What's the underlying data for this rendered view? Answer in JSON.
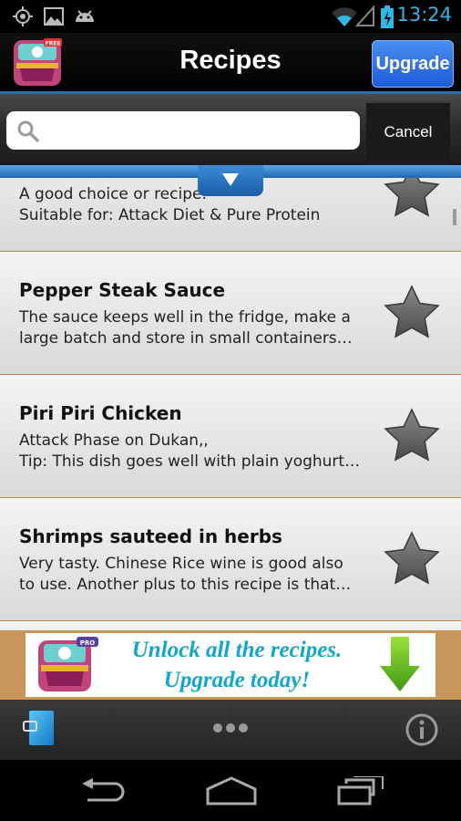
{
  "status_bar": {
    "time": "13:24",
    "icons": [
      "gps-icon",
      "image-icon",
      "android-icon",
      "wifi-icon",
      "signal-icon",
      "battery-icon"
    ]
  },
  "header": {
    "title": "Recipes",
    "upgrade_label": "Upgrade",
    "logo_badge": "FREE"
  },
  "search": {
    "value": "",
    "placeholder": "",
    "cancel_label": "Cancel"
  },
  "recipes": [
    {
      "title": "",
      "line1": "A good choice or recipe.",
      "line2": "Suitable for: Attack Diet & Pure Protein",
      "favorite": false
    },
    {
      "title": "Pepper Steak Sauce",
      "line1": "The sauce keeps well in the fridge, make a",
      "line2": "large batch and store in small containers…",
      "favorite": false
    },
    {
      "title": "Piri Piri Chicken",
      "line1": "Attack Phase on Dukan,,",
      "line2": "Tip: This dish goes well with plain yoghurt…",
      "favorite": false
    },
    {
      "title": "Shrimps sauteed in herbs",
      "line1": "Very tasty.  Chinese Rice wine is good also",
      "line2": "to use. Another plus to this recipe is that…",
      "favorite": false
    }
  ],
  "ad": {
    "line1": "Unlock all the recipes.",
    "line2": "Upgrade today!",
    "badge": "PRO"
  },
  "colors": {
    "accent_blue": "#2a6fae",
    "time_blue": "#33b5e5",
    "ad_text": "#12a7c6",
    "list_separator": "#b6884f"
  }
}
